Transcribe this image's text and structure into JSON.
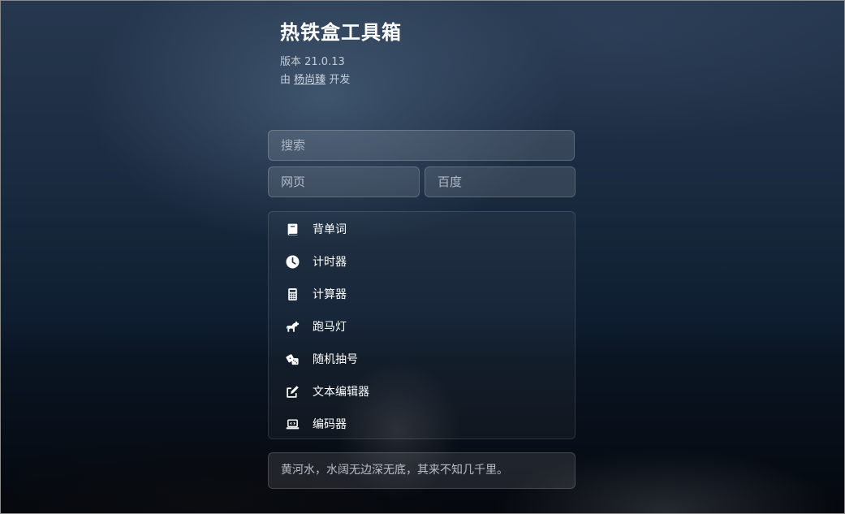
{
  "app": {
    "title": "热铁盒工具箱",
    "version": "版本 21.0.13",
    "developer_prefix": "由",
    "developer_name": "杨尚臻",
    "developer_suffix": "开发"
  },
  "search": {
    "placeholder": "搜索",
    "value": ""
  },
  "engines": [
    {
      "label": "网页"
    },
    {
      "label": "百度"
    }
  ],
  "tools": [
    {
      "label": "背单词",
      "icon": "book-icon"
    },
    {
      "label": "计时器",
      "icon": "clock-icon"
    },
    {
      "label": "计算器",
      "icon": "calculator-icon"
    },
    {
      "label": "跑马灯",
      "icon": "horse-icon"
    },
    {
      "label": "随机抽号",
      "icon": "dice-icon"
    },
    {
      "label": "文本编辑器",
      "icon": "edit-icon"
    },
    {
      "label": "编码器",
      "icon": "laptop-code-icon"
    }
  ],
  "quote": "黄河水，水阔无边深无底，其来不知几千里。",
  "colors": {
    "text": "#ffffff",
    "panel": "rgba(255,255,255,0.12)"
  }
}
